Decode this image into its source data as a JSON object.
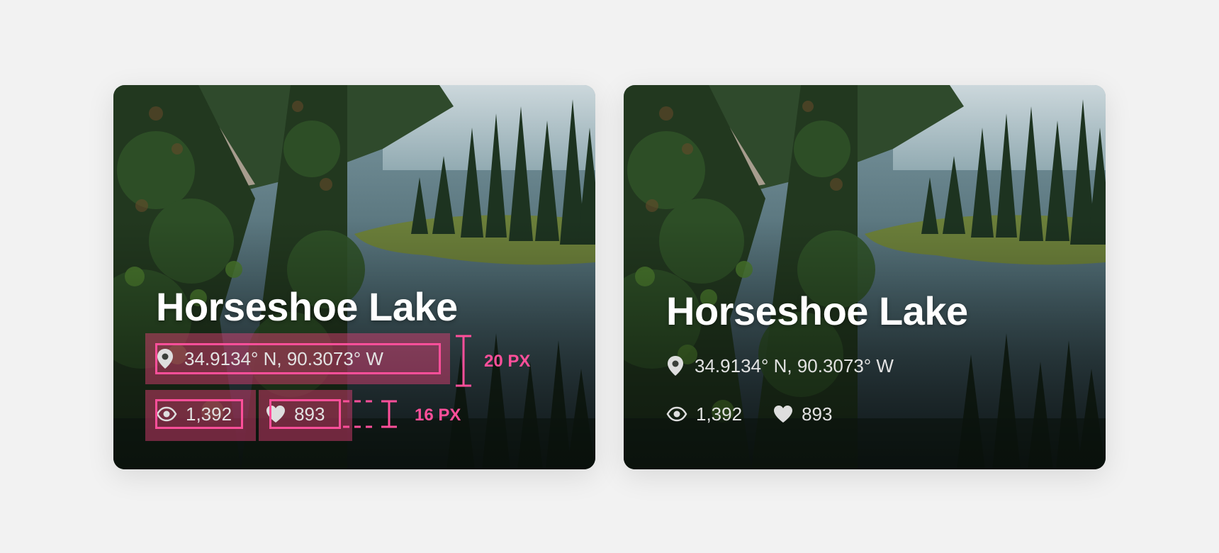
{
  "cards": [
    {
      "title": "Horseshoe Lake",
      "location": "34.9134° N, 90.3073° W",
      "views": "1,392",
      "likes": "893",
      "location_icon": "map-pin-icon",
      "views_icon": "eye-icon",
      "likes_icon": "heart-icon"
    },
    {
      "title": "Horseshoe Lake",
      "location": "34.9134° N, 90.3073° W",
      "views": "1,392",
      "likes": "893",
      "location_icon": "map-pin-icon",
      "views_icon": "eye-icon",
      "likes_icon": "heart-icon"
    }
  ],
  "annotations": {
    "gap_label_1": "20 PX",
    "gap_label_2": "16 PX",
    "accent_color": "#ff4f9a"
  }
}
